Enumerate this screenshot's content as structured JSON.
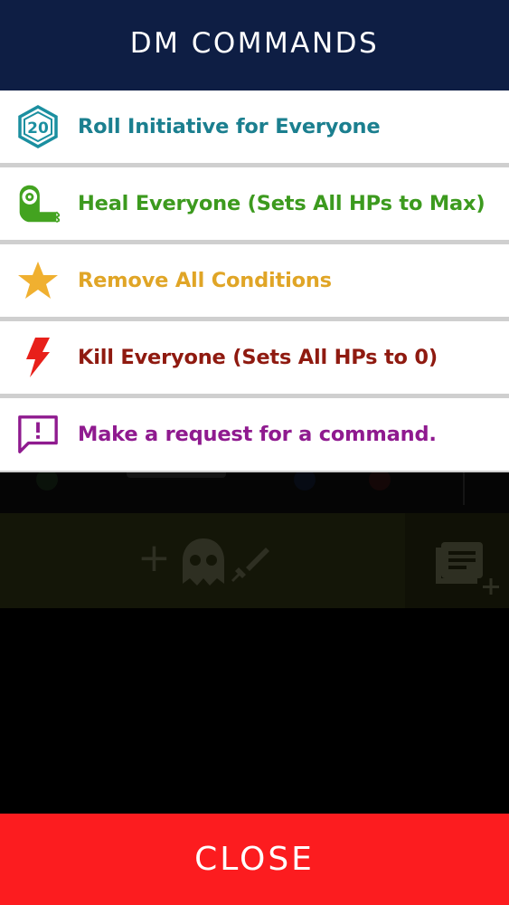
{
  "header": {
    "title": "DM COMMANDS"
  },
  "commands": [
    {
      "label": "Roll Initiative for Everyone",
      "icon": "d20-icon",
      "icon_text": "20",
      "color": "#1b7f8f"
    },
    {
      "label": "Heal Everyone (Sets All HPs to Max)",
      "icon": "bandage-roll-icon",
      "color": "#3c9a1e"
    },
    {
      "label": "Remove All Conditions",
      "icon": "star-icon",
      "color": "#e0a526"
    },
    {
      "label": "Kill Everyone (Sets All HPs to 0)",
      "icon": "lightning-bolt-icon",
      "color": "#8f1a10"
    },
    {
      "label": "Make a request for a command.",
      "icon": "feedback-message-icon",
      "color": "#8f1a8f"
    }
  ],
  "footer": {
    "close_label": "CLOSE"
  },
  "colors": {
    "header_bg": "#0e1e44",
    "close_bg": "#fc1c1f",
    "divider": "#cfcfcf",
    "overlay": "#000000"
  }
}
